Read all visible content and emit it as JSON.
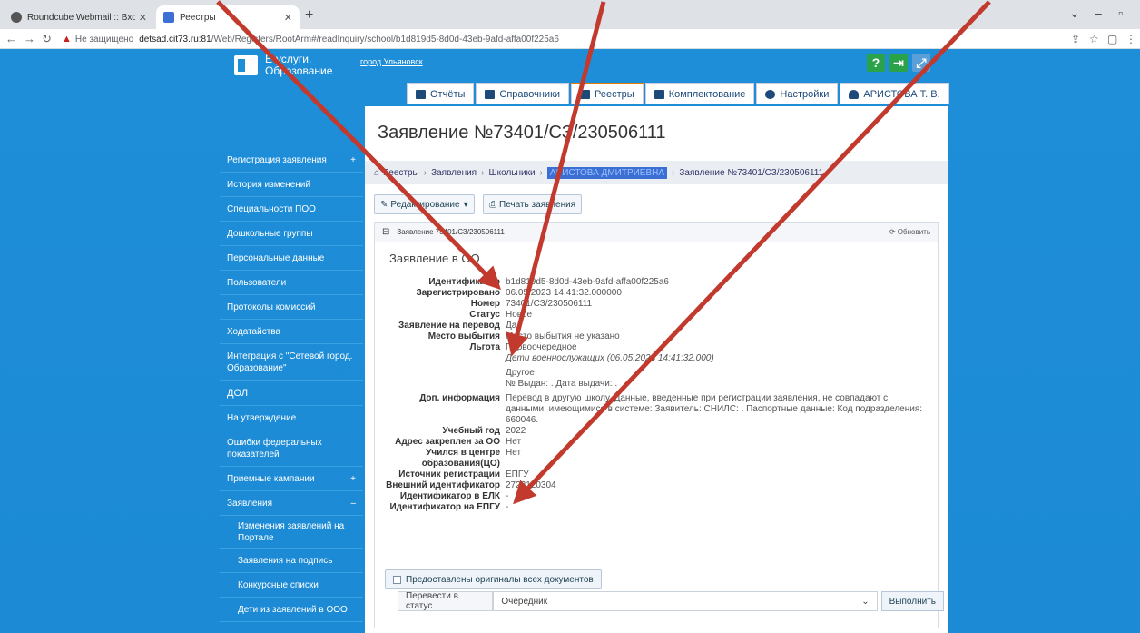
{
  "browser": {
    "tabs": [
      {
        "title": "Roundcube Webmail :: Входящие",
        "icon_color": "#3a3a3a"
      },
      {
        "title": "Реестры",
        "icon_color": "#3b6fd4"
      }
    ],
    "address": {
      "security": "Не защищено",
      "host": "detsad.cit73.ru:81",
      "path": "/Web/Registers/RootArm#/readInquiry/school/b1d819d5-8d0d-43eb-9afd-affa00f225a6"
    }
  },
  "header": {
    "logo_line1": "Е-услуги.",
    "logo_line2": "Образование",
    "city": "город Ульяновск",
    "icons": [
      "help-icon",
      "logout-icon",
      "fullscreen-icon"
    ],
    "tabs": [
      {
        "label": "Отчёты",
        "icon": "report-icon"
      },
      {
        "label": "Справочники",
        "icon": "book-icon"
      },
      {
        "label": "Реестры",
        "icon": "list-icon",
        "active": true
      },
      {
        "label": "Комплектование",
        "icon": "stack-icon"
      },
      {
        "label": "Настройки",
        "icon": "gear-icon"
      },
      {
        "label": "АРИСТОВА Т. В.",
        "icon": "user-icon"
      }
    ]
  },
  "sidebar": {
    "items": [
      "Регистрация заявления",
      "История изменений",
      "Специальности ПОО",
      "Дошкольные группы",
      "Персональные данные",
      "Пользователи",
      "Протоколы комиссий",
      "Ходатайства",
      "Интеграция с \"Сетевой город. Образование\"",
      "ДОЛ",
      "На утверждение",
      "Ошибки федеральных показателей",
      "Приемные кампании",
      "Заявления",
      "Изменения заявлений на Портале",
      "Заявления на подпись",
      "Конкурсные списки",
      "Дети из заявлений в ООО"
    ]
  },
  "main": {
    "title": "Заявление №73401/СЗ/230506111",
    "breadcrumb": [
      "Реестры",
      "Заявления",
      "Школьники",
      "АРИСТОВА ДМИТРИЕВНА",
      "Заявление №73401/СЗ/230506111"
    ],
    "edit_button": "Редактирование",
    "print_button": "Печать заявления",
    "box_header": "Заявление 73401/СЗ/230506111",
    "refresh": "Обновить",
    "subtitle": "Заявление в ОО",
    "fields": [
      {
        "k": "Идентификатор",
        "v": "b1d819d5-8d0d-43eb-9afd-affa00f225a6"
      },
      {
        "k": "Зарегистрировано",
        "v": "06.05.2023 14:41:32.000000"
      },
      {
        "k": "Номер",
        "v": "73401/СЗ/230506111"
      },
      {
        "k": "Статус",
        "v": "Новое"
      },
      {
        "k": "Заявление на перевод",
        "v": "Да"
      },
      {
        "k": "Место выбытия",
        "v": "Место выбытия не указано"
      },
      {
        "k": "Льгота",
        "v": "Первоочередное"
      },
      {
        "k": "",
        "v": "Дети военнослужащих (06.05.2023 14:41:32.000)"
      },
      {
        "k": "",
        "v": "Другое"
      },
      {
        "k": "",
        "v": "№ Выдан: . Дата выдачи: ."
      },
      {
        "k": "Доп. информация",
        "v": "Перевод в другую школу. Данные, введенные при регистрации заявления, не совпадают с данными, имеющимися в системе: Заявитель: СНИЛС: . Паспортные данные: Код подразделения: 660046."
      },
      {
        "k": "Учебный год",
        "v": "2022"
      },
      {
        "k": "Адрес закреплен за ОО",
        "v": "Нет"
      },
      {
        "k": "Учился в центре образования(ЦО)",
        "v": "Нет"
      },
      {
        "k": "Источник регистрации",
        "v": "ЕПГУ"
      },
      {
        "k": "Внешний идентификатор",
        "v": "2722120304"
      },
      {
        "k": "Идентификатор в ЕЛК",
        "v": "-"
      },
      {
        "k": "Идентификатор на ЕПГУ",
        "v": "-"
      }
    ],
    "originals_button": "Предоставлены оригиналы всех документов",
    "status_label": "Перевести в статус",
    "status_value": "Очередник",
    "execute_button": "Выполнить"
  },
  "annotation": {
    "arrow_color": "#c23a2e"
  }
}
